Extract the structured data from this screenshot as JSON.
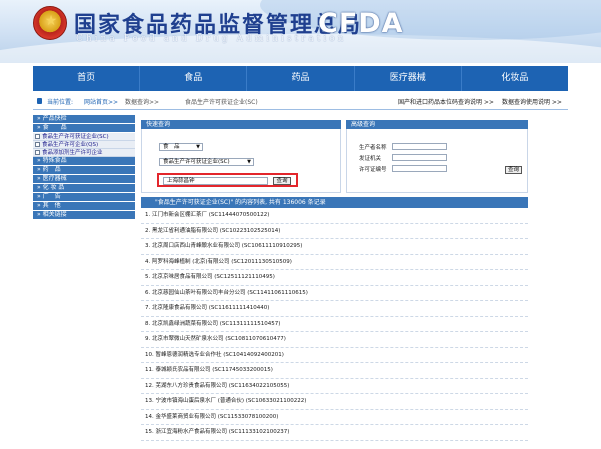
{
  "header": {
    "title": "国家食品药品监督管理总局",
    "subtitle": "China Food and Drug Administration",
    "logo_text": "CFDA",
    "emblem_icon": "national-emblem"
  },
  "mainnav": {
    "items": [
      "首页",
      "食品",
      "药品",
      "医疗器械",
      "化妆品"
    ]
  },
  "breadcrumb": {
    "label": "当前位置:",
    "home": "网站首页>>",
    "level2": "数据查询>>",
    "level3": "食品生产许可获证企业(SC)",
    "right1": "国产和进口药品本位码查询说明 >>",
    "right2": "数据查询使用说明 >>"
  },
  "sidebar": {
    "food_head": "产品快检",
    "food_section": "食　　品",
    "food_items": [
      "食品生产许可获证企业(SC)",
      "食品生产许可企业(QS)",
      "食品添加剂生产许可企业"
    ],
    "heads": [
      "特殊食品",
      "药　品",
      "医疗器械",
      "化 妆 品",
      "广　告",
      "其　他",
      "相关链接"
    ]
  },
  "quick_search": {
    "title": "快速查询",
    "category": "食　品",
    "database": "食品生产许可获证企业(SC)",
    "input_value": "上海蒜昌钟",
    "button": "查询"
  },
  "advanced_search": {
    "title": "高级查询",
    "fields": [
      "生产者名称",
      "发证机关",
      "许可证编号"
    ],
    "button": "查询"
  },
  "results": {
    "header": "\"食品生产许可获证企业(SC)\" 的内容列表, 共有 136006 条记录",
    "rows": [
      "1. 江门市新会区棚汇茶厂 (SC11444070500122)",
      "2. 黑龙江省利通油脂有限公司 (SC10223102525014)",
      "3. 北京周口店西山青峰酿水业有限公司 (SC10611110910295)",
      "4. 阿罗科海峰植制 (北京)有限公司 (SC12011130510509)",
      "5. 北京京味居食品有限公司 (SC12511121110495)",
      "6. 北京慈园仙山茶叶有限公司丰台分公司 (SC11411061110615)",
      "7. 北京隆康食品有限公司 (SC11611111410440)",
      "8. 北京凯鑫绿洲蔬菜有限公司 (SC11311111510457)",
      "9. 北京市翠微山天然矿泉水公司 (SC10811070610477)",
      "10. 暂峰恩德润精选专业合作社 (SC10414092400201)",
      "11. 泰城颖氏农品有限公司 (SC11745033200015)",
      "12. 芜湖东八方珍贵食品有限公司 (SC11634022105055)",
      "13. 宁波市镇海山蛋后泉水厂 (普通合伙) (SC10633021100222)",
      "14. 金华盛莱商贸业有限公司 (SC11533078100200)",
      "15. 浙江宜海粉水产食品有限公司 (SC11133102100237)"
    ]
  }
}
